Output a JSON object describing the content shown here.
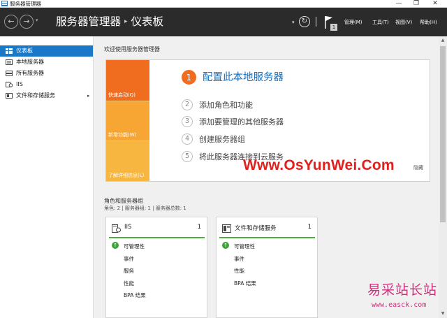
{
  "window": {
    "title": "服务器管理器",
    "minimize_glyph": "—",
    "maximize_glyph": "❐",
    "close_glyph": "✕"
  },
  "header": {
    "back_glyph": "←",
    "forward_glyph": "→",
    "history_glyph": "▾",
    "breadcrumb_root": "服务器管理器",
    "breadcrumb_separator": "▸",
    "breadcrumb_current": "仪表板",
    "refresh_caret": "▾",
    "refresh_glyph": "↻",
    "notification_count": "1",
    "menu": [
      "管理(M)",
      "工具(T)",
      "视图(V)",
      "帮助(H)"
    ]
  },
  "sidebar": {
    "expand_glyph": "▸",
    "items": [
      {
        "label": "仪表板",
        "icon": "dashboard-icon"
      },
      {
        "label": "本地服务器",
        "icon": "server-icon"
      },
      {
        "label": "所有服务器",
        "icon": "servers-icon"
      },
      {
        "label": "IIS",
        "icon": "iis-icon"
      },
      {
        "label": "文件和存储服务",
        "icon": "storage-icon"
      }
    ]
  },
  "welcome": {
    "title": "欢迎使用服务器管理器",
    "tiles": [
      "快速启动(Q)",
      "新增功能(W)",
      "了解详细信息(L)"
    ],
    "steps": [
      {
        "num": "1",
        "text": "配置此本地服务器"
      },
      {
        "num": "2",
        "text": "添加角色和功能"
      },
      {
        "num": "3",
        "text": "添加要管理的其他服务器"
      },
      {
        "num": "4",
        "text": "创建服务器组"
      },
      {
        "num": "5",
        "text": "将此服务器连接到云服务"
      }
    ],
    "hide_label": "隐藏"
  },
  "roles": {
    "title": "角色和服务器组",
    "subtitle": "角色: 2 | 服务器组: 1 | 服务器总数: 1",
    "cards": [
      {
        "title": "IIS",
        "count": "1",
        "rows": [
          "可管理性",
          "事件",
          "服务",
          "性能",
          "BPA 结果"
        ]
      },
      {
        "title": "文件和存储服务",
        "count": "1",
        "rows": [
          "可管理性",
          "事件",
          "性能",
          "BPA 结果"
        ]
      }
    ]
  },
  "watermarks": {
    "main": "Www.OsYunWei.Com",
    "corner_cn": "易采站长站",
    "corner_url": "www.easck.com"
  },
  "colors": {
    "header_bg": "#2b2b2b",
    "active_item": "#1a78c8",
    "tile_orange": "#f06d1f",
    "tile_amber": "#f7a533",
    "link_blue": "#1a6eb8",
    "status_green": "#4caf3e",
    "watermark_red": "#e0201c"
  }
}
